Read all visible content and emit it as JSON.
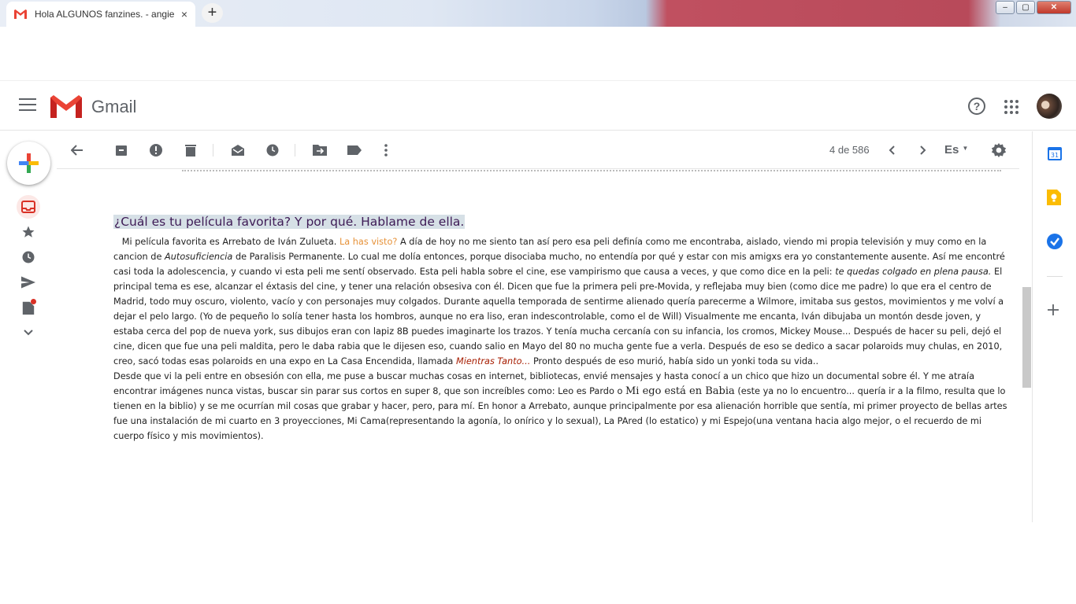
{
  "browser": {
    "tab_title": "Hola ALGUNOS fanzines. - angie",
    "tab_close": "×",
    "new_tab": "+",
    "window_buttons": [
      "–",
      "▢",
      "✕"
    ]
  },
  "header": {
    "app_name": "Gmail",
    "help": "?"
  },
  "toolbar": {
    "pager": "4 de 586",
    "lang": "Es"
  },
  "email": {
    "question": "¿Cuál es tu película favorita? Y por qué. Hablame de ella.",
    "p1_a": "Mi película favorita es Arrebato de Iván Zulueta.",
    "p1_orange": "La has visto?",
    "p1_b": "A día de hoy no me siento tan así pero esa peli definía como me encontraba, aislado, viendo mi propia televisión y muy como en la cancion de",
    "p1_ital": "Autosuficiencia",
    "p1_c": "de Paralisis Permanente. Lo cual me dolía entonces, porque disociaba mucho, no entendía por qué y estar con mis amigxs era yo constantemente ausente. Así me encontré casi toda la adolescencia, y cuando vi esta peli me sentí observado. Esta peli habla sobre el cine, ese vampirismo que causa a veces, y que como dice en la peli:",
    "p1_ital2": "te quedas colgado en plena pausa.",
    "p1_d": "El principal tema es ese, alcanzar el éxtasis del cine, y tener una relación obsesiva con él. Dicen que fue la primera peli pre-Movida, y reflejaba muy bien (como dice me padre) lo que era el centro de Madrid, todo muy oscuro, violento, vacío y con personajes muy colgados. Durante aquella temporada de sentirme alienado quería parecerme a Wilmore, imitaba sus gestos, movimientos y me volví a dejar el pelo largo. (Yo de pequeño lo solía tener hasta los hombros, aunque no era liso, eran indescontrolable, como el de Will) Visualmente me encanta, Iván dibujaba un montón desde joven, y estaba cerca del pop de nueva york, sus dibujos eran con lapiz 8B puedes imaginarte los trazos. Y tenía mucha cercanía con su infancia, los cromos, Mickey Mouse... Después de hacer su peli, dejó el cine, dicen que fue una peli maldita, pero le daba rabia que le dijesen eso, cuando salio en Mayo del 80 no mucha gente fue a verla. Después de eso se dedico a sacar polaroids muy chulas, en 2010, creo, sacó todas esas polaroids en una expo en La Casa Encendida, llamada",
    "p1_red": "Mientras Tanto...",
    "p1_e": "Pronto después de eso murió, había sido un yonki toda su vida..",
    "p2_a": "Desde que vi la peli entre en obsesión con ella, me puse a buscar muchas cosas en internet, bibliotecas, envié mensajes y hasta conocí a un chico que hizo un documental sobre él. Y me atraía encontrar imágenes nunca vistas, buscar sin parar sus cortos en super 8, que son increíbles como: Leo  es  Pardo o",
    "p2_serif": "Mi ego está en Babia",
    "p2_b": "(este ya no lo encuentro... quería ir a la filmo, resulta que lo tienen en la biblio) y se me ocurrían mil cosas que grabar y hacer, pero, para mí. En honor a Arrebato, aunque principalmente por esa alienación horrible que sentía, mi primer proyecto de bellas artes fue una instalación de mi cuarto en 3 proyecciones, Mi Cama(representando la agonía, lo onírico y lo sexual), La PAred (lo estatico) y mi Espejo(una ventana hacia algo mejor, o el recuerdo de mi cuerpo físico y mis movimientos)."
  },
  "colors": {
    "gmail_red": "#ea4335",
    "question_highlight": "#d6e0e6",
    "orange_text": "#e69138",
    "link_red": "#a61c00"
  }
}
